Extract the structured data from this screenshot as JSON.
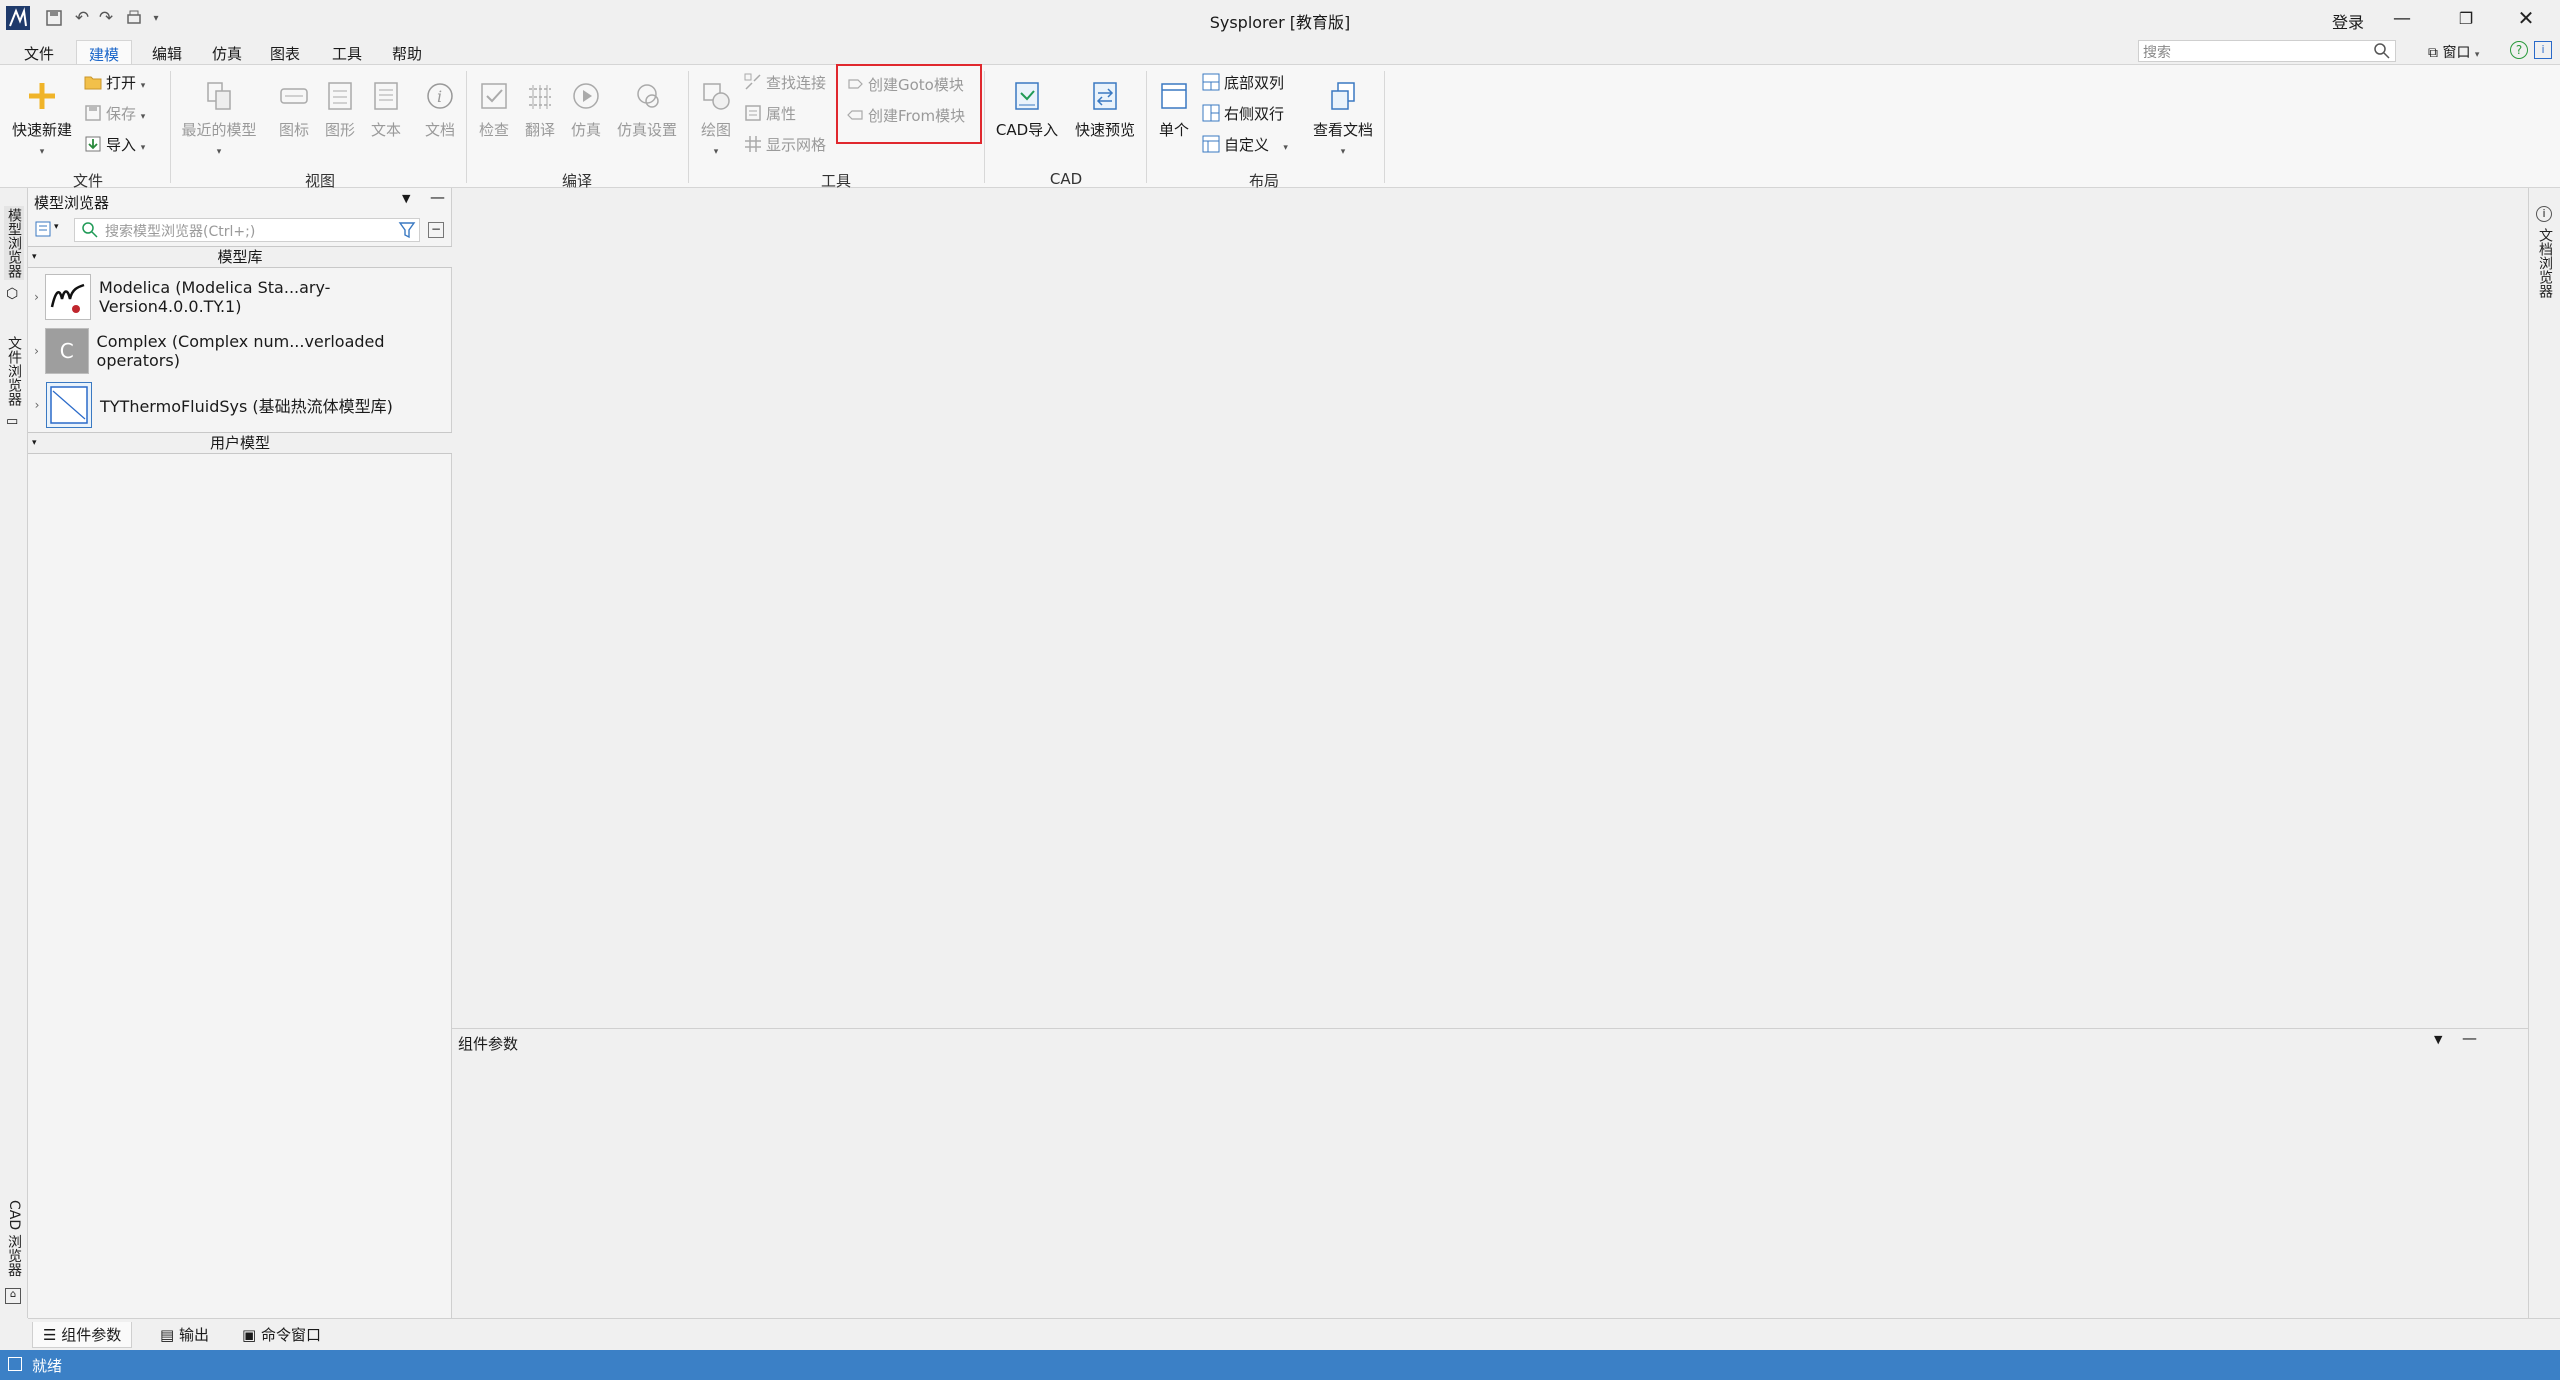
{
  "app": {
    "title": "Sysplorer [教育版]",
    "login": "登录"
  },
  "menu": [
    "文件",
    "建模",
    "编辑",
    "仿真",
    "图表",
    "工具",
    "帮助"
  ],
  "search": {
    "placeholder": "搜索"
  },
  "window_btn": "窗口",
  "ribbon": {
    "file": {
      "label": "文件",
      "new": "快速新建",
      "open": "打开",
      "save": "保存",
      "import": "导入"
    },
    "view": {
      "label": "视图",
      "recent": "最近的模型",
      "icon": "图标",
      "diagram": "图形",
      "text": "文本",
      "doc": "文档"
    },
    "compile": {
      "label": "编译",
      "check": "检查",
      "translate": "翻译",
      "simulate": "仿真",
      "sim_settings": "仿真设置"
    },
    "tools": {
      "label": "工具",
      "draw": "绘图",
      "find_conn": "查找连接",
      "props": "属性",
      "grid": "显示网格",
      "goto": "创建Goto模块",
      "from": "创建From模块"
    },
    "cad": {
      "label": "CAD",
      "import": "CAD导入",
      "preview": "快速预览"
    },
    "layout": {
      "label": "布局",
      "single": "单个",
      "bottom2": "底部双列",
      "right2": "右侧双行",
      "custom": "自定义",
      "view_doc": "查看文档"
    }
  },
  "left_strip": {
    "model_browser": "模型浏览器",
    "file_browser": "文件浏览器",
    "cad_browser": "CAD 浏览器"
  },
  "browser": {
    "title": "模型浏览器",
    "search_placeholder": "搜索模型浏览器(Ctrl+;)",
    "lib_header": "模型库",
    "libs": [
      "Modelica (Modelica Sta...ary-Version4.0.0.TY.1)",
      "Complex (Complex num...verloaded operators)",
      "TYThermoFluidSys (基础热流体模型库)"
    ],
    "complex_letter": "C",
    "user_header": "用户模型"
  },
  "params": {
    "title": "组件参数"
  },
  "right_strip": {
    "doc_browser": "文档浏览器"
  },
  "bottom_tabs": [
    "组件参数",
    "输出",
    "命令窗口"
  ],
  "status": "就绪",
  "colors": {
    "accent": "#1b66c9",
    "status_bar": "#3b80c6",
    "highlight": "#e0282e"
  }
}
